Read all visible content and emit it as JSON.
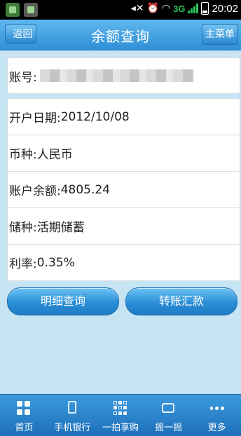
{
  "status_bar": {
    "network": "3G",
    "time": "20:02"
  },
  "header": {
    "back_label": "返回",
    "title": "余额查询",
    "menu_label": "主菜单"
  },
  "account": {
    "label": "账号:"
  },
  "details": [
    {
      "label": "开户日期:",
      "value": "2012/10/08"
    },
    {
      "label": "币种:",
      "value": "人民币"
    },
    {
      "label": "账户余额:",
      "value": "4805.24"
    },
    {
      "label": "储种:",
      "value": "活期储蓄"
    },
    {
      "label": "利率:",
      "value": "0.35%"
    }
  ],
  "actions": {
    "detail_query": "明细查询",
    "transfer": "转账汇款"
  },
  "bottom_nav": [
    {
      "label": "首页",
      "icon": "home-grid-icon"
    },
    {
      "label": "手机银行",
      "icon": "phone-icon"
    },
    {
      "label": "一拍享购",
      "icon": "qr-code-icon"
    },
    {
      "label": "摇一摇",
      "icon": "shake-icon"
    },
    {
      "label": "更多",
      "icon": "more-icon"
    }
  ],
  "colors": {
    "header": "#2f8fd6",
    "background": "#c6e4f3",
    "nav": "#1d6fb8"
  }
}
